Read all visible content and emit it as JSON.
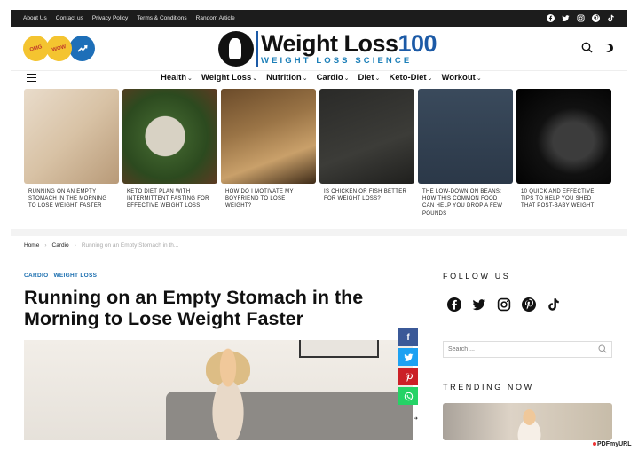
{
  "topbar": {
    "links": [
      "About Us",
      "Contact us",
      "Privacy Policy",
      "Terms & Conditions",
      "Random Article"
    ],
    "social_icons": [
      "facebook-icon",
      "twitter-icon",
      "instagram-icon",
      "pinterest-icon",
      "tiktok-icon"
    ]
  },
  "header": {
    "badges": [
      {
        "label": "OMG",
        "color": "#f4c430"
      },
      {
        "label": "WOW",
        "color": "#f4c430"
      },
      {
        "label": "",
        "icon": "trending-icon",
        "color": "#1e6fb8"
      }
    ],
    "logo": {
      "title_main": "Weight Loss",
      "title_num": "100",
      "subtitle": "WEIGHT LOSS SCIENCE"
    },
    "icons": [
      "search-icon",
      "dark-mode-toggle-icon"
    ]
  },
  "nav": {
    "items": [
      {
        "label": "Health"
      },
      {
        "label": "Weight Loss"
      },
      {
        "label": "Nutrition"
      },
      {
        "label": "Cardio"
      },
      {
        "label": "Diet"
      },
      {
        "label": "Keto-Diet"
      },
      {
        "label": "Workout"
      }
    ]
  },
  "cards": [
    {
      "caption": "RUNNING ON AN EMPTY STOMACH IN THE MORNING TO LOSE WEIGHT FASTER"
    },
    {
      "caption": "KETO DIET PLAN WITH INTERMITTENT FASTING FOR EFFECTIVE WEIGHT LOSS"
    },
    {
      "caption": "HOW DO I MOTIVATE MY BOYFRIEND TO LOSE WEIGHT?"
    },
    {
      "caption": "IS CHICKEN OR FISH BETTER FOR WEIGHT LOSS?"
    },
    {
      "caption": "THE LOW-DOWN ON BEANS: HOW THIS COMMON FOOD CAN HELP YOU DROP A FEW POUNDS"
    },
    {
      "caption": "10 QUICK AND EFFECTIVE TIPS TO HELP YOU SHED THAT POST-BABY WEIGHT"
    }
  ],
  "breadcrumb": {
    "home": "Home",
    "section": "Cardio",
    "current": "Running on an Empty Stomach in th..."
  },
  "article": {
    "categories": [
      "CARDIO",
      "WEIGHT LOSS"
    ],
    "title": "Running on an Empty Stomach in the Morning to Lose Weight Faster"
  },
  "share": {
    "facebook": "f",
    "twitter": "t",
    "pinterest": "P",
    "whatsapp": "W"
  },
  "sidebar": {
    "follow_title": "FOLLOW US",
    "follow_icons": [
      "facebook-icon",
      "twitter-icon",
      "instagram-icon",
      "pinterest-icon",
      "tiktok-icon"
    ],
    "search_placeholder": "Search ...",
    "trending_title": "TRENDING NOW"
  },
  "watermark": "PDFmyURL",
  "colors": {
    "accent": "#1c6fb0",
    "topbar": "#1c1c1c"
  }
}
